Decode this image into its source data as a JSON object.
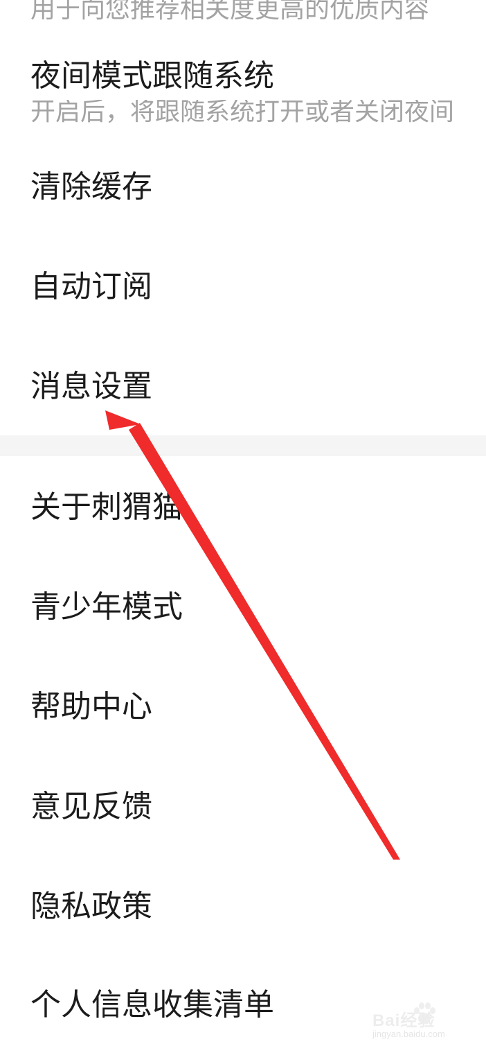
{
  "settings": {
    "top_subtext": "用于向您推荐相关度更高的优质内容",
    "night_mode": {
      "label": "夜间模式跟随系统",
      "subtext": "开启后，将跟随系统打开或者关闭夜间"
    },
    "clear_cache": "清除缓存",
    "auto_subscribe": "自动订阅",
    "message_settings": "消息设置",
    "about": "关于刺猬猫",
    "youth_mode": "青少年模式",
    "help_center": "帮助中心",
    "feedback": "意见反馈",
    "privacy_policy": "隐私政策",
    "personal_info_list": "个人信息收集清单"
  },
  "annotation": {
    "arrow_color": "#f02b2b"
  },
  "watermark": {
    "brand": "Bai经验",
    "url": "jingyan.baidu.com"
  }
}
